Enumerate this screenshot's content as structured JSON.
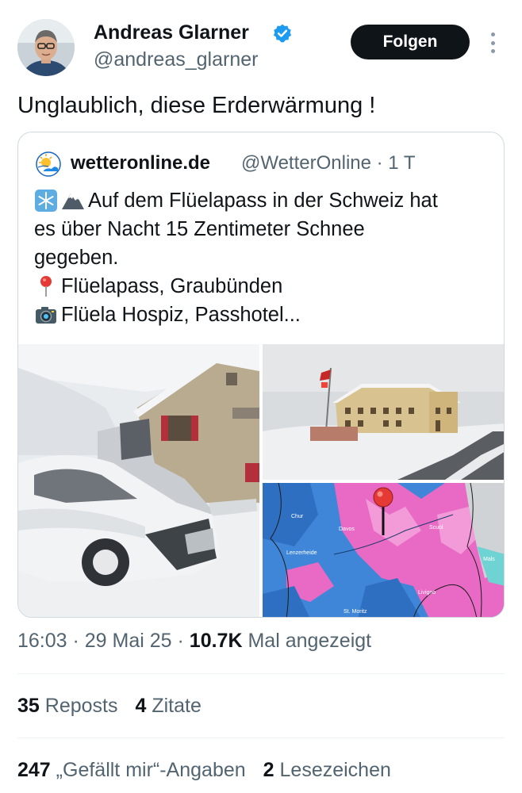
{
  "author": {
    "name": "Andreas Glarner",
    "handle": "@andreas_glarner",
    "verified_color": "#1d9bf0"
  },
  "follow_label": "Folgen",
  "more_icon": "more-vertical-icon",
  "tweet_text": "Unglaublich, diese Erderwärmung !",
  "quoted": {
    "name": "wetteronline.de",
    "handle_time": "@WetterOnline · 1 T",
    "lines": [
      "Auf dem Flüelapass in der Schweiz hat",
      "es über Nacht 15 Zentimeter Schnee",
      "gegeben.",
      "Flüelapass, Graubünden",
      "Flüela Hospiz, Passhotel..."
    ],
    "icons": [
      "snowflake-icon",
      "mountain-icon",
      "pin-icon",
      "camera-icon"
    ],
    "map_labels": [
      "Chur",
      "Davos",
      "Scuol",
      "Lenzerheide",
      "St. Moritz",
      "Livigno",
      "Mals"
    ]
  },
  "meta": {
    "time_date": "16:03 · 29 Mai 25 · ",
    "views_count": "10.7K",
    "views_label": " Mal angezeigt"
  },
  "stats": {
    "reposts_count": "35",
    "reposts_label": "Reposts",
    "quotes_count": "4",
    "quotes_label": "Zitate",
    "likes_count": "247",
    "likes_label": "„Gefällt mir“-Angaben",
    "bookmarks_count": "2",
    "bookmarks_label": "Lesezeichen"
  }
}
